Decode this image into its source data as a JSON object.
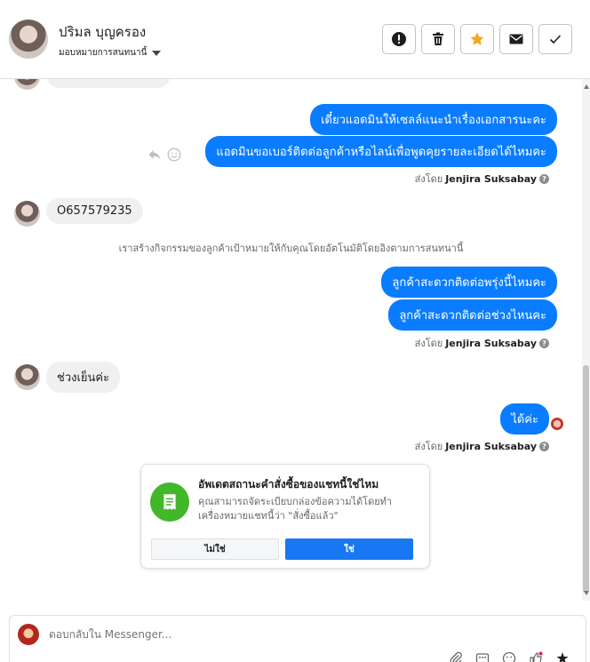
{
  "header": {
    "contact_name": "ปริมล บุญครอง",
    "assign_label": "มอบหมายการสนทนานี้",
    "actions": [
      "alert-icon",
      "trash-icon",
      "star-icon",
      "mail-icon",
      "check-icon"
    ],
    "star_color": "#f5a623"
  },
  "messages": {
    "out1": "เดี๋ยวแอดมินให้เซลล์แนะนำเรื่องเอกสารนะคะ",
    "out2": "แอดมินขอเบอร์ติดต่อลูกค้าหรือไลน์เพื่อพูดคุยรายละเอียดได้ไหมคะ",
    "sent_by_prefix": "ส่งโดย",
    "sent_by_name": "Jenjira Suksabay",
    "in1": "O657579235",
    "system_note": "เราสร้างกิจกรรมของลูกค้าเป้าหมายให้กับคุณโดยอัตโนมัติโดยอิงตามการสนทนานี้",
    "out3": "ลูกค้าสะดวกติดต่อพรุ่งนี้ไหมคะ",
    "out4": "ลูกค้าสะดวกติดต่อช่วงไหนคะ",
    "in2": "ช่วงเย็นค่ะ",
    "out5": "ได้ค่ะ"
  },
  "order_card": {
    "title": "อัพเดตสถานะคำสั่งซื้อของแชทนี้ใช่ไหม",
    "description": "คุณสามารถจัดระเบียบกล่องข้อความได้โดยทำเครื่องหมายแชทนี้ว่า \"สั่งซื้อแล้ว\"",
    "no_label": "ไม่ใช่",
    "yes_label": "ใช่",
    "accent_color": "#42b72a",
    "primary_color": "#1877f2"
  },
  "composer": {
    "placeholder": "ตอบกลับใน Messenger..."
  },
  "colors": {
    "bubble_out": "#0a7cff",
    "bubble_in": "#f0f0f0"
  }
}
